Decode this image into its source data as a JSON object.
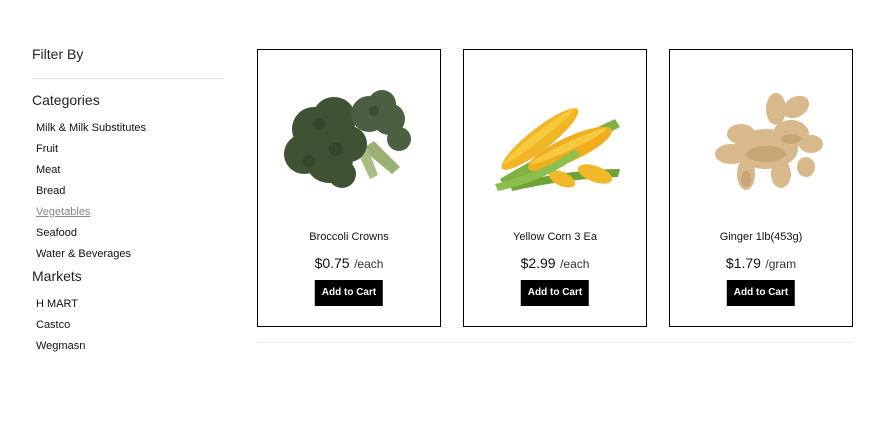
{
  "sidebar": {
    "filter_title": "Filter By",
    "categories_title": "Categories",
    "categories": [
      {
        "label": "Milk & Milk Substitutes",
        "active": false
      },
      {
        "label": "Fruit",
        "active": false
      },
      {
        "label": "Meat",
        "active": false
      },
      {
        "label": "Bread",
        "active": false
      },
      {
        "label": "Vegetables",
        "active": true
      },
      {
        "label": "Seafood",
        "active": false
      },
      {
        "label": "Water & Beverages",
        "active": false
      }
    ],
    "markets_title": "Markets",
    "markets": [
      {
        "label": "H MART"
      },
      {
        "label": "Castco"
      },
      {
        "label": "Wegmasn"
      }
    ]
  },
  "products": [
    {
      "name": "Broccoli Crowns",
      "price": "$0.75",
      "unit": "/each",
      "button": "Add to Cart",
      "image": "broccoli-image"
    },
    {
      "name": "Yellow Corn 3 Ea",
      "price": "$2.99",
      "unit": "/each",
      "button": "Add to Cart",
      "image": "corn-image"
    },
    {
      "name": "Ginger 1lb(453g)",
      "price": "$1.79",
      "unit": "/gram",
      "button": "Add to Cart",
      "image": "ginger-image"
    }
  ]
}
